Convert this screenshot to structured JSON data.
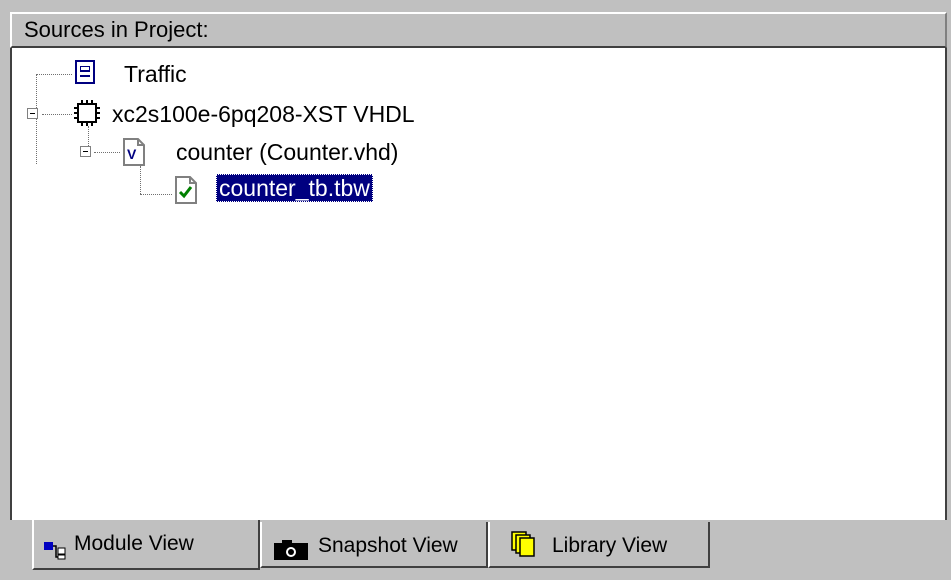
{
  "header": {
    "title": "Sources in Project:"
  },
  "tree": {
    "items": [
      {
        "label": "Traffic",
        "icon": "project-icon"
      },
      {
        "label": "xc2s100e-6pq208-XST VHDL",
        "icon": "chip-icon",
        "expanded": true
      },
      {
        "label": "counter (Counter.vhd)",
        "icon": "vhdl-file-icon",
        "expanded": true
      },
      {
        "label": "counter_tb.tbw",
        "icon": "testbench-file-icon",
        "selected": true
      }
    ]
  },
  "tabs": [
    {
      "label": "Module View",
      "icon": "module-view-icon",
      "active": true
    },
    {
      "label": "Snapshot View",
      "icon": "camera-icon"
    },
    {
      "label": "Library View",
      "icon": "library-icon"
    }
  ],
  "colors": {
    "selection": "#000080",
    "background": "#c0c0c0",
    "tree_bg": "#ffffff"
  }
}
